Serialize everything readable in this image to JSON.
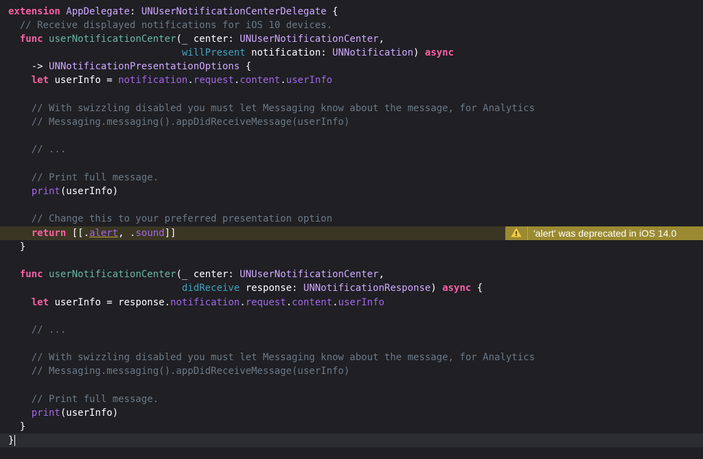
{
  "editor": {
    "lines": {
      "l1": {
        "a": "extension",
        "b": "AppDelegate",
        "c": ": ",
        "d": "UNUserNotificationCenterDelegate",
        "e": " {"
      },
      "l2": {
        "a": "  // Receive displayed notifications for iOS 10 devices."
      },
      "l3": {
        "a": "  ",
        "b": "func",
        "c": " ",
        "d": "userNotificationCenter",
        "e": "(_ center: ",
        "f": "UNUserNotificationCenter",
        "g": ","
      },
      "l4": {
        "a": "                              ",
        "b": "willPresent",
        "c": " notification: ",
        "d": "UNNotification",
        "e": ") ",
        "f": "async"
      },
      "l5": {
        "a": "    -> ",
        "b": "UNNotificationPresentationOptions",
        "c": " {"
      },
      "l6": {
        "a": "    ",
        "b": "let",
        "c": " userInfo = ",
        "d": "notification",
        "e": ".",
        "f": "request",
        "g": ".",
        "h": "content",
        "i": ".",
        "j": "userInfo"
      },
      "l7": {
        "a": ""
      },
      "l8": {
        "a": "    // With swizzling disabled you must let Messaging know about the message, for Analytics"
      },
      "l9": {
        "a": "    // Messaging.messaging().appDidReceiveMessage(userInfo)"
      },
      "l10": {
        "a": ""
      },
      "l11": {
        "a": "    // ..."
      },
      "l12": {
        "a": ""
      },
      "l13": {
        "a": "    // Print full message."
      },
      "l14": {
        "a": "    ",
        "b": "print",
        "c": "(userInfo)"
      },
      "l15": {
        "a": ""
      },
      "l16": {
        "a": "    // Change this to your preferred presentation option"
      },
      "l17": {
        "a": "    ",
        "b": "return",
        "c": " [[.",
        "d": "alert",
        "e": ", .",
        "f": "sound",
        "g": "]]"
      },
      "l18": {
        "a": "  }"
      },
      "l19": {
        "a": ""
      },
      "l20": {
        "a": "  ",
        "b": "func",
        "c": " ",
        "d": "userNotificationCenter",
        "e": "(_ center: ",
        "f": "UNUserNotificationCenter",
        "g": ","
      },
      "l21": {
        "a": "                              ",
        "b": "didReceive",
        "c": " response: ",
        "d": "UNNotificationResponse",
        "e": ") ",
        "f": "async",
        "g": " {"
      },
      "l22": {
        "a": "    ",
        "b": "let",
        "c": " userInfo = response.",
        "d": "notification",
        "e": ".",
        "f": "request",
        "g": ".",
        "h": "content",
        "i": ".",
        "j": "userInfo"
      },
      "l23": {
        "a": ""
      },
      "l24": {
        "a": "    // ..."
      },
      "l25": {
        "a": ""
      },
      "l26": {
        "a": "    // With swizzling disabled you must let Messaging know about the message, for Analytics"
      },
      "l27": {
        "a": "    // Messaging.messaging().appDidReceiveMessage(userInfo)"
      },
      "l28": {
        "a": ""
      },
      "l29": {
        "a": "    // Print full message."
      },
      "l30": {
        "a": "    ",
        "b": "print",
        "c": "(userInfo)"
      },
      "l31": {
        "a": "  }"
      },
      "l32": {
        "a": "}"
      }
    },
    "warning": {
      "icon": "warning-triangle-icon",
      "message": "'alert' was deprecated in iOS 14.0"
    }
  },
  "colors": {
    "background": "#1f1f24",
    "keyword": "#fc5fa3",
    "type": "#d0a8ff",
    "function": "#67b7a4",
    "property": "#a167e6",
    "parameter_label": "#41a1c0",
    "comment": "#6c7986",
    "plain": "#ffffff",
    "warning_badge": "#9b8a31",
    "warning_line": "#3a3623"
  }
}
